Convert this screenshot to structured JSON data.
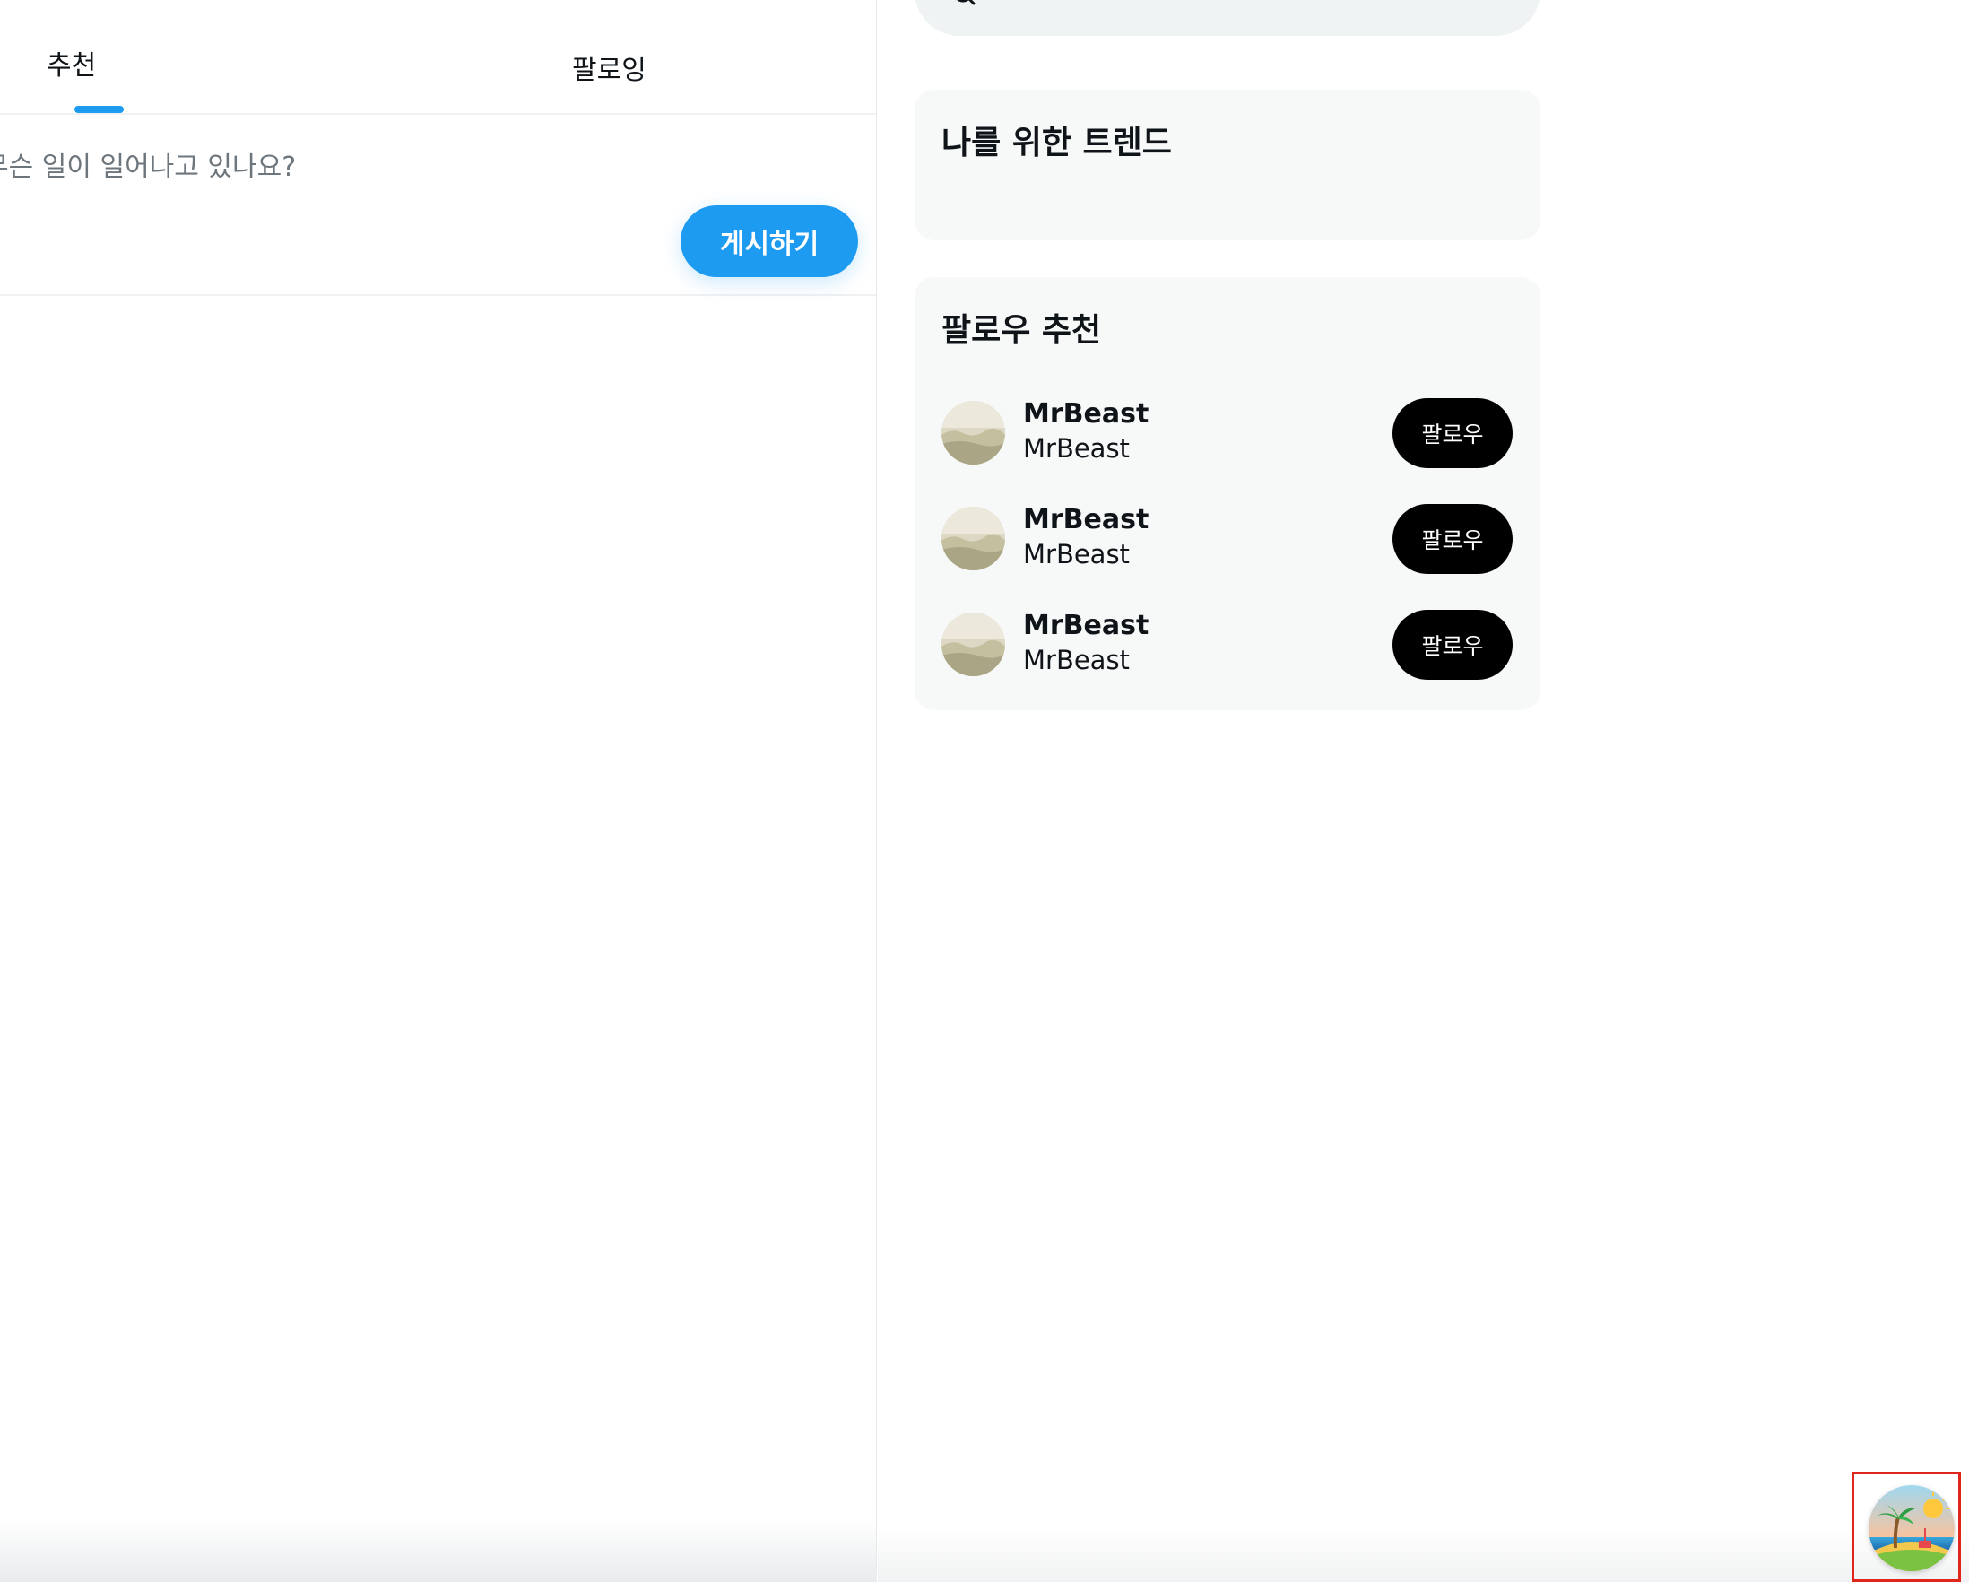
{
  "tabs": [
    {
      "label": "추천",
      "active": true
    },
    {
      "label": "팔로잉",
      "active": false
    }
  ],
  "composer": {
    "placeholder": "무슨 일이 일어나고 있나요?",
    "post_label": "게시하기"
  },
  "sidebar": {
    "search": {
      "icon": "search-icon"
    },
    "trends": {
      "title": "나를 위한 트렌드"
    },
    "who_to_follow": {
      "title": "팔로우 추천",
      "users": [
        {
          "name": "MrBeast",
          "handle": "MrBeast",
          "follow_label": "팔로우"
        },
        {
          "name": "MrBeast",
          "handle": "MrBeast",
          "follow_label": "팔로우"
        },
        {
          "name": "MrBeast",
          "handle": "MrBeast",
          "follow_label": "팔로우"
        }
      ]
    }
  },
  "widget": {
    "icon": "beach-island-icon"
  },
  "colors": {
    "accent": "#1d9bf0",
    "follow_button": "#000000",
    "card_background": "#f7f9f9",
    "highlight_frame": "#e0261b"
  }
}
